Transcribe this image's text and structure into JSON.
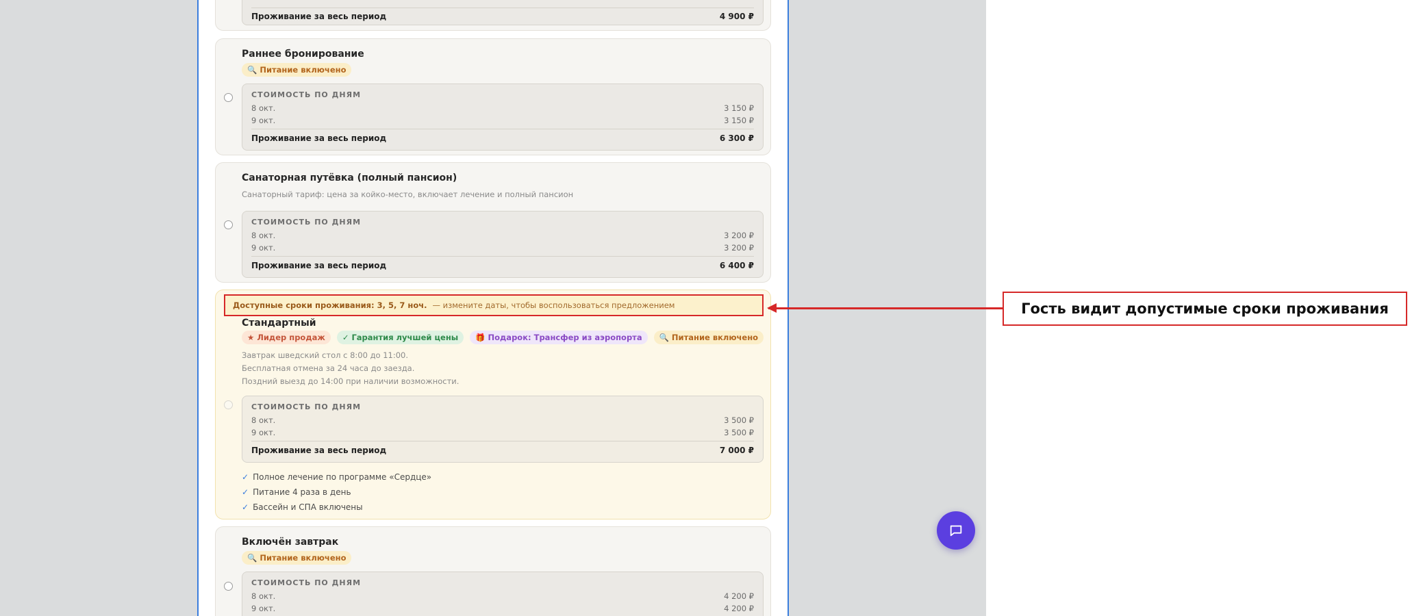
{
  "rates": [
    {
      "title": "",
      "breakdown": {
        "total_label": "Проживание за весь период",
        "total": "4 900 ₽"
      }
    },
    {
      "title": "Раннее бронирование",
      "badges": [
        {
          "icon": "magnifier-icon",
          "text": "🔍 Питание включено"
        }
      ],
      "breakdown": {
        "heading": "СТОИМОСТЬ ПО ДНЯМ",
        "rows": [
          {
            "date": "8 окт.",
            "price": "3 150 ₽"
          },
          {
            "date": "9 окт.",
            "price": "3 150 ₽"
          }
        ],
        "total_label": "Проживание за весь период",
        "total": "6 300 ₽"
      }
    },
    {
      "title": "Санаторная путёвка (полный пансион)",
      "description": "Санаторный тариф: цена за койко-место, включает лечение и полный пансион",
      "breakdown": {
        "heading": "СТОИМОСТЬ ПО ДНЯМ",
        "rows": [
          {
            "date": "8 окт.",
            "price": "3 200 ₽"
          },
          {
            "date": "9 окт.",
            "price": "3 200 ₽"
          }
        ],
        "total_label": "Проживание за весь период",
        "total": "6 400 ₽"
      }
    },
    {
      "notice_strong": "Доступные сроки проживания: 3, 5, 7 ноч.",
      "notice_rest": "— измените даты, чтобы воспользоваться предложением",
      "title": "Стандартный",
      "badges": [
        {
          "icon": "star-icon",
          "text": "★ Лидер продаж"
        },
        {
          "icon": "check-icon",
          "text": "✓ Гарантия лучшей цены"
        },
        {
          "icon": "gift-icon",
          "text": "🎁 Подарок: Трансфер из аэропорта"
        },
        {
          "icon": "magnifier-icon",
          "text": "🔍 Питание включено"
        }
      ],
      "description_lines": [
        "Завтрак шведский стол с 8:00 до 11:00.",
        "Бесплатная отмена за 24 часа до заезда.",
        "Поздний выезд до 14:00 при наличии возможности."
      ],
      "breakdown": {
        "heading": "СТОИМОСТЬ ПО ДНЯМ",
        "rows": [
          {
            "date": "8 окт.",
            "price": "3 500 ₽"
          },
          {
            "date": "9 окт.",
            "price": "3 500 ₽"
          }
        ],
        "total_label": "Проживание за весь период",
        "total": "7 000 ₽"
      },
      "features": [
        "Полное лечение по программе «Сердце»",
        "Питание 4 раза в день",
        "Бассейн и СПА включены"
      ]
    },
    {
      "title": "Включён завтрак",
      "badges": [
        {
          "icon": "magnifier-icon",
          "text": "🔍 Питание включено"
        }
      ],
      "breakdown": {
        "heading": "СТОИМОСТЬ ПО ДНЯМ",
        "rows": [
          {
            "date": "8 окт.",
            "price": "4 200 ₽"
          },
          {
            "date": "9 окт.",
            "price": "4 200 ₽"
          }
        ]
      }
    }
  ],
  "callout": {
    "text": "Гость видит допустимые сроки проживания"
  },
  "chat_button": {
    "icon": "chat-icon"
  },
  "colors": {
    "annotation": "#d62828",
    "chat": "#5b3fe0",
    "panel_border": "#3b7ddd"
  }
}
